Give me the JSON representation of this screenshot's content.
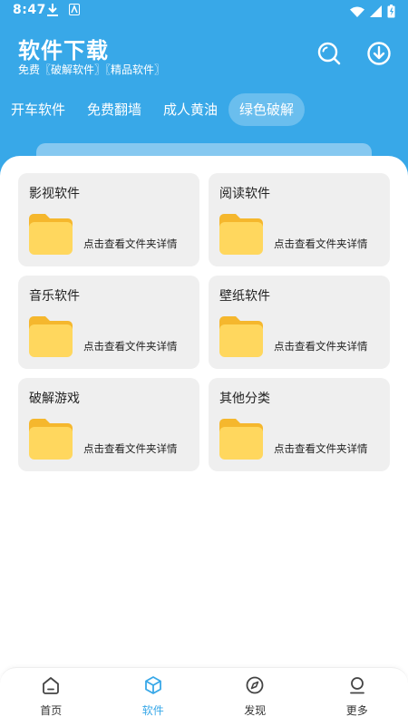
{
  "status_bar": {
    "time": "8:47"
  },
  "header": {
    "title": "软件下载",
    "subtitle": "免费〖破解软件〗〖精品软件〗",
    "search_icon": "search-icon",
    "download_icon": "download-icon"
  },
  "tabs": [
    {
      "label": "开车软件",
      "active": false
    },
    {
      "label": "免费翻墙",
      "active": false
    },
    {
      "label": "成人黄油",
      "active": false
    },
    {
      "label": "绿色破解",
      "active": true
    }
  ],
  "cards": [
    {
      "title": "影视软件",
      "hint": "点击查看文件夹详情"
    },
    {
      "title": "阅读软件",
      "hint": "点击查看文件夹详情"
    },
    {
      "title": "音乐软件",
      "hint": "点击查看文件夹详情"
    },
    {
      "title": "壁纸软件",
      "hint": "点击查看文件夹详情"
    },
    {
      "title": "破解游戏",
      "hint": "点击查看文件夹详情"
    },
    {
      "title": "其他分类",
      "hint": "点击查看文件夹详情"
    }
  ],
  "bottom_nav": [
    {
      "label": "首页",
      "icon": "home-icon",
      "active": false
    },
    {
      "label": "软件",
      "icon": "box-icon",
      "active": true
    },
    {
      "label": "发现",
      "icon": "compass-icon",
      "active": false
    },
    {
      "label": "更多",
      "icon": "user-icon",
      "active": false
    }
  ],
  "colors": {
    "accent": "#38a8e8",
    "card_bg": "#efefef",
    "folder_yellow": "#ffd75e",
    "folder_back": "#f5b72d"
  }
}
